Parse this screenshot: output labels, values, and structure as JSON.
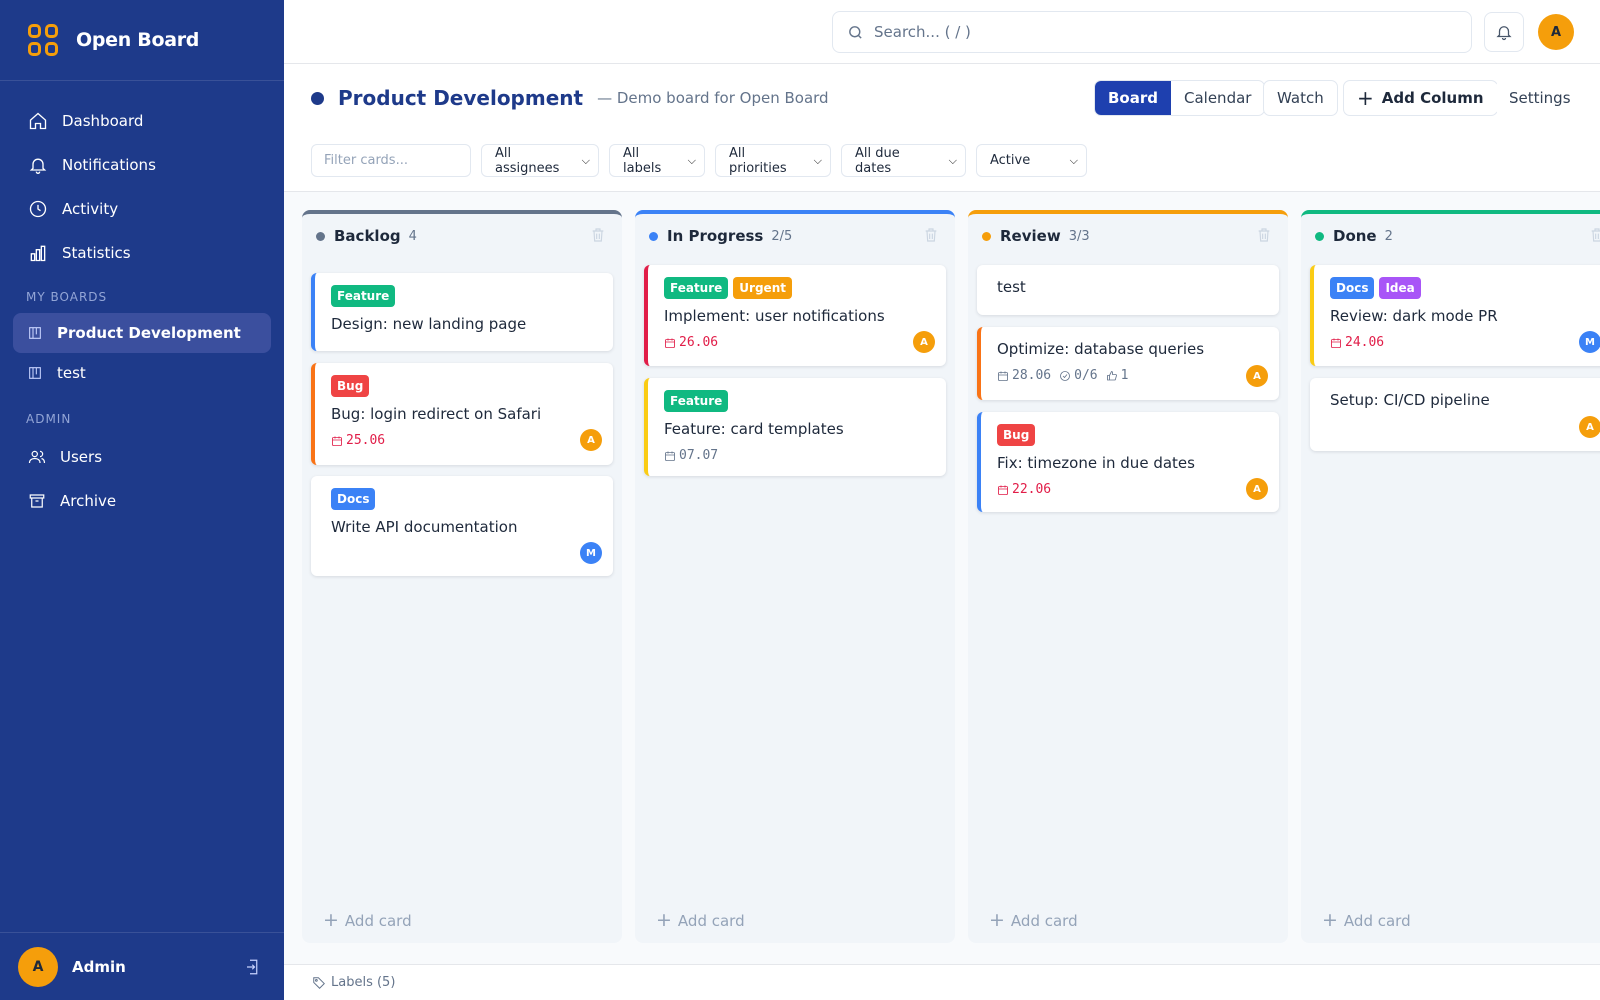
{
  "app": {
    "name": "Open Board"
  },
  "sidebar": {
    "nav": [
      {
        "label": "Dashboard",
        "icon": "home-icon"
      },
      {
        "label": "Notifications",
        "icon": "bell-icon"
      },
      {
        "label": "Activity",
        "icon": "clock-icon"
      },
      {
        "label": "Statistics",
        "icon": "bar-chart-icon"
      }
    ],
    "boards_title": "MY BOARDS",
    "boards": [
      {
        "label": "Product Development",
        "active": true
      },
      {
        "label": "test",
        "active": false
      }
    ],
    "admin_title": "ADMIN",
    "admin": [
      {
        "label": "Users",
        "icon": "users-icon"
      },
      {
        "label": "Archive",
        "icon": "archive-icon"
      }
    ],
    "user": {
      "initial": "A",
      "name": "Admin"
    }
  },
  "topbar": {
    "search_placeholder": "Search... ( / )",
    "avatar_initial": "A"
  },
  "board": {
    "title": "Product Development",
    "description": "— Demo board for Open Board",
    "views": [
      "Board",
      "Calendar"
    ],
    "active_view": "Board",
    "watch_label": "Watch",
    "add_column_label": "Add Column",
    "settings_label": "Settings",
    "filter_placeholder": "Filter cards...",
    "filters": [
      "All assignees",
      "All labels",
      "All priorities",
      "All due dates",
      "Active"
    ]
  },
  "columns": [
    {
      "name": "Backlog",
      "count": "4",
      "color": "#64748b",
      "cards": [
        {
          "labels": [
            {
              "text": "Feature",
              "color": "#10b981"
            }
          ],
          "title": "Design: new landing page",
          "accent": "#3b82f6"
        },
        {
          "labels": [
            {
              "text": "Bug",
              "color": "#ef4444"
            }
          ],
          "title": "Bug: login redirect on Safari",
          "date": "25.06",
          "overdue": true,
          "assignee": "A",
          "accent": "#f97316"
        },
        {
          "labels": [
            {
              "text": "Docs",
              "color": "#3b82f6"
            }
          ],
          "title": "Write API documentation",
          "assignee": "M",
          "accent": ""
        }
      ],
      "add_label": "Add card"
    },
    {
      "name": "In Progress",
      "count": "2/5",
      "color": "#3b82f6",
      "cards": [
        {
          "labels": [
            {
              "text": "Feature",
              "color": "#10b981"
            },
            {
              "text": "Urgent",
              "color": "#f59e0b"
            }
          ],
          "title": "Implement: user notifications",
          "date": "26.06",
          "overdue": true,
          "assignee": "A",
          "accent": "#e11d48"
        },
        {
          "labels": [
            {
              "text": "Feature",
              "color": "#10b981"
            }
          ],
          "title": "Feature: card templates",
          "date": "07.07",
          "overdue": false,
          "accent": "#facc15"
        }
      ],
      "add_label": "Add card"
    },
    {
      "name": "Review",
      "count": "3/3",
      "color": "#f59e0b",
      "cards": [
        {
          "labels": [],
          "title": "test",
          "accent": ""
        },
        {
          "labels": [],
          "title": "Optimize: database queries",
          "date": "28.06",
          "overdue": false,
          "checklist": "0/6",
          "votes": "1",
          "assignee": "A",
          "accent": "#f97316"
        },
        {
          "labels": [
            {
              "text": "Bug",
              "color": "#ef4444"
            }
          ],
          "title": "Fix: timezone in due dates",
          "date": "22.06",
          "overdue": true,
          "assignee": "A",
          "accent": "#3b82f6"
        }
      ],
      "add_label": "Add card"
    },
    {
      "name": "Done",
      "count": "2",
      "color": "#10b981",
      "cards": [
        {
          "labels": [
            {
              "text": "Docs",
              "color": "#3b82f6"
            },
            {
              "text": "Idea",
              "color": "#a855f7"
            }
          ],
          "title": "Review: dark mode PR",
          "date": "24.06",
          "overdue": true,
          "assignee": "M",
          "accent": "#facc15"
        },
        {
          "labels": [],
          "title": "Setup: CI/CD pipeline",
          "assignee": "A",
          "accent": ""
        }
      ],
      "add_label": "Add card"
    }
  ],
  "footer": {
    "labels_text": "Labels (5)"
  }
}
